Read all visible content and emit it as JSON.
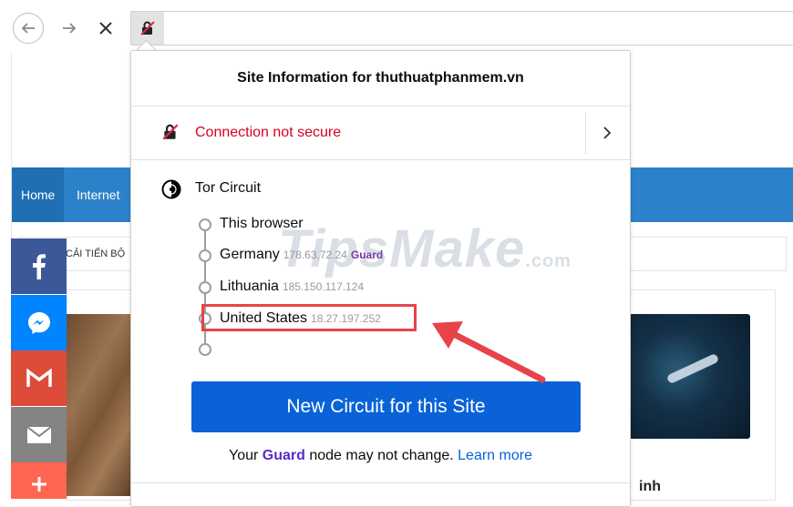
{
  "toolbar": {
    "back_icon": "back-arrow-icon",
    "forward_icon": "forward-arrow-icon",
    "stop_icon": "stop-icon",
    "url_value": ""
  },
  "webpage": {
    "nav": [
      "Home",
      "Internet"
    ],
    "ticker_text": "CẢI TIẾN BỘ",
    "heading_fragment": "inh"
  },
  "share_bar": [
    "facebook",
    "messenger",
    "gmail",
    "email",
    "more"
  ],
  "popup": {
    "title": "Site Information for thuthuatphanmem.vn",
    "connection_label": "Connection not secure",
    "circuit_title": "Tor Circuit",
    "nodes": [
      {
        "name": "This browser",
        "ip": "",
        "badge": ""
      },
      {
        "name": "Germany",
        "ip": "178.63.72.24",
        "badge": "Guard"
      },
      {
        "name": "Lithuania",
        "ip": "185.150.117.124",
        "badge": ""
      },
      {
        "name": "United States",
        "ip": "18.27.197.252",
        "badge": ""
      }
    ],
    "new_circuit_button": "New Circuit for this Site",
    "footer": {
      "prefix": "Your",
      "guard": "Guard",
      "middle": "node may not change.",
      "link": "Learn more"
    }
  },
  "watermark": {
    "main": "TipsMake",
    "suffix": ".com"
  },
  "colors": {
    "insecure": "#d70022",
    "button": "#0a62d8",
    "guard": "#7c2aa8",
    "highlight": "#e8434a",
    "navbar": "#2b82c9"
  }
}
